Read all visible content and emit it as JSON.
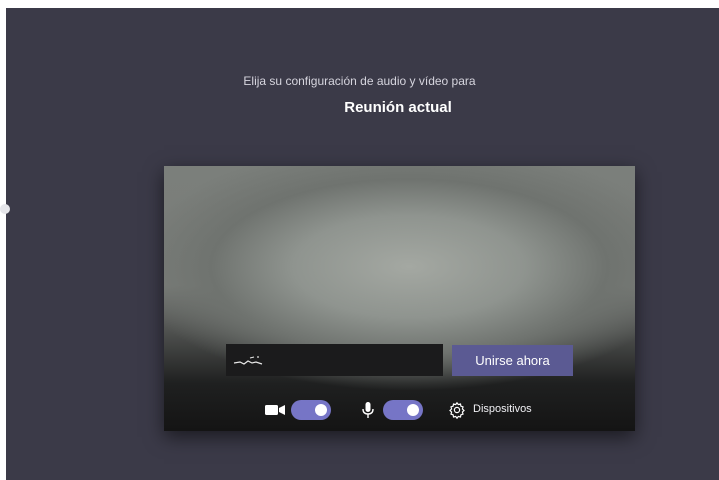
{
  "prejoin": {
    "subtitle": "Elija su configuración de audio y vídeo para",
    "title": "Reunión actual",
    "join_button_label": "Unirse ahora",
    "devices_label": "Dispositivos",
    "camera_on": true,
    "mic_on": true
  },
  "icons": {
    "camera": "video-camera-icon",
    "microphone": "microphone-icon",
    "devices": "gear-icon"
  },
  "colors": {
    "background": "#3b3a48",
    "accent": "#5b5a93",
    "toggle_on": "#7675c6"
  }
}
